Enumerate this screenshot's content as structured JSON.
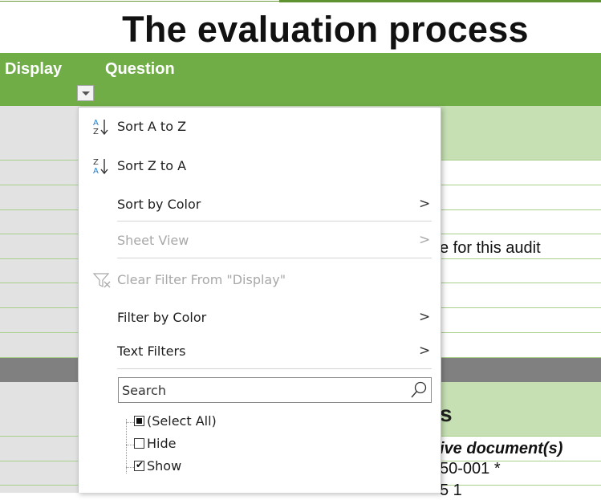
{
  "sheet": {
    "title": "The evaluation process",
    "headers": {
      "display": "Display",
      "question": "Question"
    },
    "cells": {
      "audit_text": "e for this audit",
      "section_letter": "s",
      "doc_header": "ive document(s)",
      "number_1": "50-001 *",
      "number_2": "5 1"
    },
    "colors": {
      "header_green": "#70ad47",
      "light_green": "#c6e0b4",
      "dark_gray_row": "#808080",
      "text_white": "#ffffff"
    }
  },
  "filter_menu": {
    "items": [
      {
        "label": "Sort A to Z",
        "icon": "sort-ascending-icon",
        "enabled": true
      },
      {
        "label": "Sort Z to A",
        "icon": "sort-descending-icon",
        "enabled": true
      },
      {
        "label": "Sort by Color",
        "enabled": true,
        "submenu": true
      },
      {
        "label": "Sheet View",
        "enabled": false,
        "submenu": true
      },
      {
        "label": "Clear Filter From \"Display\"",
        "icon": "clear-filter-icon",
        "enabled": false
      },
      {
        "label": "Filter by Color",
        "enabled": true,
        "submenu": true
      },
      {
        "label": "Text Filters",
        "enabled": true,
        "submenu": true
      }
    ],
    "search": {
      "placeholder": "Search",
      "icon": "search-icon"
    },
    "values": [
      {
        "label": "(Select All)",
        "state": "indeterminate"
      },
      {
        "label": "Hide",
        "state": "unchecked"
      },
      {
        "label": "Show",
        "state": "checked"
      }
    ],
    "submenu_glyph": ">"
  }
}
